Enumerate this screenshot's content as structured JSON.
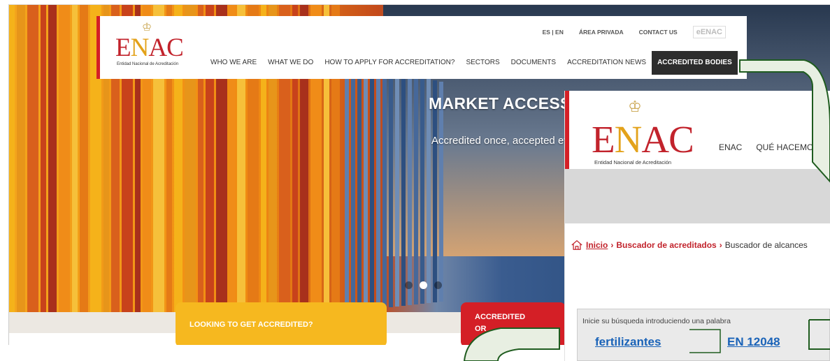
{
  "background_page": {
    "logo": {
      "wordmark_e": "E",
      "wordmark_n": "N",
      "wordmark_ac": "AC",
      "tagline": "Entidad Nacional de Acreditación"
    },
    "top_links": [
      {
        "label": "ES | EN"
      },
      {
        "label": "ÁREA PRIVADA"
      },
      {
        "label": "CONTACT US"
      },
      {
        "label": "eENAC"
      }
    ],
    "nav": [
      {
        "label": "WHO WE ARE",
        "active": false
      },
      {
        "label": "WHAT WE DO",
        "active": false
      },
      {
        "label": "HOW TO APPLY FOR ACCREDITATION?",
        "active": false
      },
      {
        "label": "SECTORS",
        "active": false
      },
      {
        "label": "DOCUMENTS",
        "active": false
      },
      {
        "label": "ACCREDITATION NEWS",
        "active": false
      },
      {
        "label": "ACCREDITED BODIES",
        "active": true
      }
    ],
    "hero": {
      "title": "MARKET ACCESS",
      "subtitle": "Accredited once, accepted ev",
      "slides": 3,
      "active_slide": 2
    },
    "cta_yellow": "LOOKING TO GET ACCREDITED?",
    "cta_red_line1": "ACCREDITED",
    "cta_red_line2": "OR"
  },
  "overlay": {
    "logo": {
      "wordmark_e": "E",
      "wordmark_n": "N",
      "wordmark_ac": "AC",
      "tagline": "Entidad Nacional de Acreditación"
    },
    "nav": [
      {
        "label": "ENAC"
      },
      {
        "label": "QUÉ HACEMOS"
      }
    ],
    "breadcrumb": {
      "home": "Inicio",
      "parent": "Buscador de acreditados",
      "current": "Buscador de alcances",
      "separator": "›"
    },
    "search": {
      "hint": "Inicie su búsqueda introduciendo una palabra",
      "keywords": [
        "fertilizantes",
        "EN 12048"
      ]
    }
  },
  "colors": {
    "brand_red": "#d41f26",
    "brand_gold": "#e3a21a",
    "cta_yellow": "#f6b81f",
    "link_blue": "#1a63b8",
    "nav_active_bg": "#2d2d2d",
    "callout_stroke": "#1f5c1f",
    "callout_fill": "#e8efe2"
  }
}
